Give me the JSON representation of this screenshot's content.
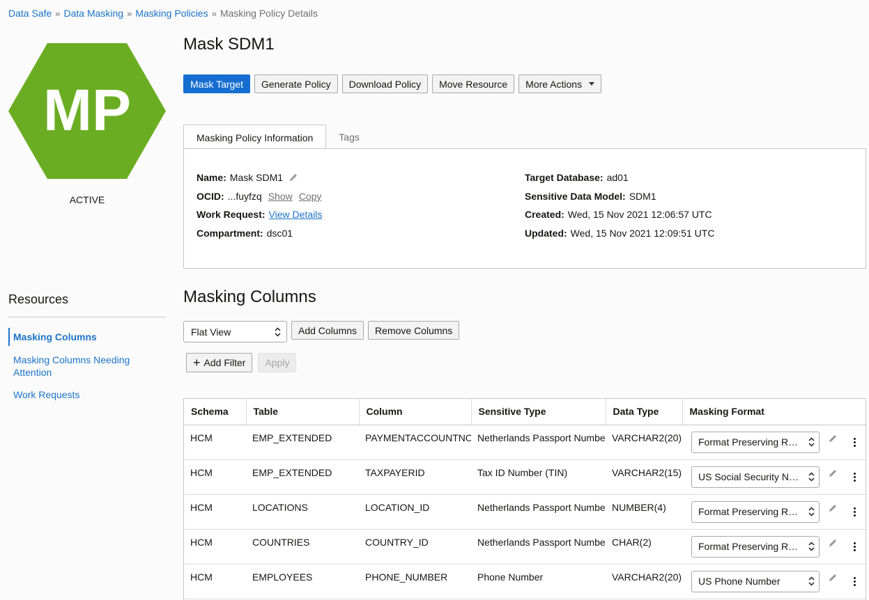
{
  "breadcrumb": {
    "items": [
      "Data Safe",
      "Data Masking",
      "Masking Policies"
    ],
    "current": "Masking Policy Details",
    "separator": "»"
  },
  "resource_icon": {
    "initials": "MP",
    "color": "#6aad22",
    "status": "ACTIVE"
  },
  "page_title": "Mask SDM1",
  "actions": {
    "mask_target": "Mask Target",
    "generate_policy": "Generate Policy",
    "download_policy": "Download Policy",
    "move_resource": "Move Resource",
    "more_actions": "More Actions"
  },
  "tabs": [
    "Masking Policy Information",
    "Tags"
  ],
  "info": {
    "name_label": "Name:",
    "name_value": "Mask SDM1",
    "ocid_label": "OCID:",
    "ocid_value": "...fuyfzq",
    "ocid_show": "Show",
    "ocid_copy": "Copy",
    "work_request_label": "Work Request:",
    "work_request_link": "View Details",
    "compartment_label": "Compartment:",
    "compartment_value": "dsc01",
    "target_db_label": "Target Database:",
    "target_db_value": "ad01",
    "sdm_label": "Sensitive Data Model:",
    "sdm_value": "SDM1",
    "created_label": "Created:",
    "created_value": "Wed, 15 Nov 2021 12:06:57 UTC",
    "updated_label": "Updated:",
    "updated_value": "Wed, 15 Nov 2021 12:09:51 UTC"
  },
  "resources": {
    "title": "Resources",
    "items": [
      "Masking Columns",
      "Masking Columns Needing Attention",
      "Work Requests"
    ],
    "active": "Masking Columns"
  },
  "masking_columns": {
    "title": "Masking Columns",
    "view_select": "Flat View",
    "add_columns": "Add Columns",
    "remove_columns": "Remove Columns",
    "add_filter": "Add Filter",
    "apply": "Apply",
    "headers": [
      "Schema",
      "Table",
      "Column",
      "Sensitive Type",
      "Data Type",
      "Masking Format"
    ],
    "rows": [
      [
        "HCM",
        "EMP_EXTENDED",
        "PAYMENTACCOUNTNO",
        "Netherlands Passport Number",
        "VARCHAR2(20)",
        "Format Preserving Rand..."
      ],
      [
        "HCM",
        "EMP_EXTENDED",
        "TAXPAYERID",
        "Tax ID Number (TIN)",
        "VARCHAR2(15)",
        "US Social Security Num..."
      ],
      [
        "HCM",
        "LOCATIONS",
        "LOCATION_ID",
        "Netherlands Passport Number",
        "NUMBER(4)",
        "Format Preserving Rand..."
      ],
      [
        "HCM",
        "COUNTRIES",
        "COUNTRY_ID",
        "Netherlands Passport Number",
        "CHAR(2)",
        "Format Preserving Rand..."
      ],
      [
        "HCM",
        "EMPLOYEES",
        "PHONE_NUMBER",
        "Phone Number",
        "VARCHAR2(20)",
        "US Phone Number"
      ]
    ]
  }
}
